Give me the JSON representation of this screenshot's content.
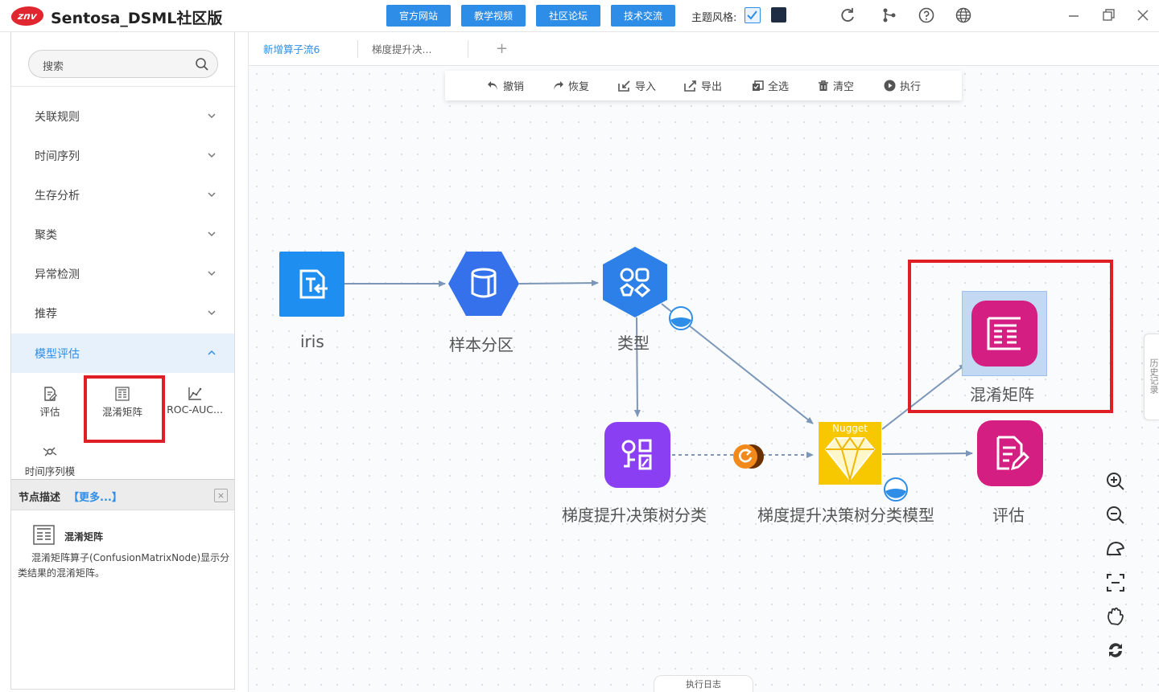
{
  "app": {
    "logo_text": "znv",
    "title": "Sentosa_DSML社区版",
    "top_buttons": [
      "官方网站",
      "教学视频",
      "社区论坛",
      "技术交流"
    ],
    "theme_label": "主题风格:",
    "accent_color": "#2e8de6",
    "highlight_color": "#e01e26"
  },
  "sidebar": {
    "search_placeholder": "搜索",
    "categories": [
      {
        "label": "关联规则",
        "expanded": false
      },
      {
        "label": "时间序列",
        "expanded": false
      },
      {
        "label": "生存分析",
        "expanded": false
      },
      {
        "label": "聚类",
        "expanded": false
      },
      {
        "label": "异常检测",
        "expanded": false
      },
      {
        "label": "推荐",
        "expanded": false
      },
      {
        "label": "模型评估",
        "expanded": true
      }
    ],
    "nodes": [
      {
        "label": "评估",
        "icon": "evaluate-icon"
      },
      {
        "label": "混淆矩阵",
        "icon": "confusion-matrix-icon"
      },
      {
        "label": "ROC-AUC...",
        "icon": "roc-auc-icon"
      },
      {
        "label": "时间序列模",
        "icon": "time-series-eval-icon"
      }
    ]
  },
  "description": {
    "title": "节点描述",
    "more": "【更多...】",
    "close": "×",
    "node_name": "混淆矩阵",
    "text": "混淆矩阵算子(ConfusionMatrixNode)显示分类结果的混淆矩阵。"
  },
  "tabs": [
    {
      "label": "新增算子流6",
      "selected": true
    },
    {
      "label": "梯度提升决...",
      "selected": false
    }
  ],
  "toolbar": {
    "undo": "撤销",
    "redo": "恢复",
    "import": "导入",
    "export": "导出",
    "select_all": "全选",
    "clear": "清空",
    "execute": "执行"
  },
  "flow": {
    "nodes": {
      "iris": "iris",
      "sample": "样本分区",
      "type": "类型",
      "gbdt": "梯度提升决策树分类",
      "model": "梯度提升决策树分类模型",
      "nugget_badge": "Nugget",
      "confusion": "混淆矩阵",
      "evaluate": "评估"
    }
  },
  "history_tab": "历史记录",
  "log_tab": "执行日志"
}
